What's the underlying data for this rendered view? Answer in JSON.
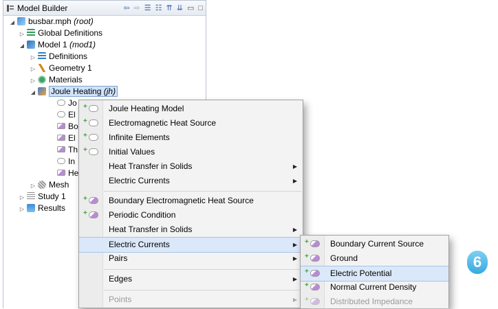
{
  "window": {
    "title": "Model Builder",
    "title_icon": "model-tree-icon"
  },
  "toolbar": {
    "icons": [
      "back-arrow-icon",
      "forward-arrow-icon",
      "expand-icon",
      "collapse-icon",
      "sort-up-icon",
      "sort-down-icon",
      "minimize-icon",
      "maximize-icon"
    ]
  },
  "tree": {
    "root": {
      "name": "busbar.mph",
      "suffix": "(root)"
    },
    "global": "Global Definitions",
    "model": {
      "name": "Model 1",
      "suffix": "(mod1)"
    },
    "definitions": "Definitions",
    "geometry": "Geometry 1",
    "materials": "Materials",
    "joule": {
      "name": "Joule Heating",
      "suffix": "(jh)"
    },
    "children": [
      "Jo",
      "El",
      "Bo",
      "El",
      "Th",
      "In",
      "He"
    ],
    "mesh": "Mesh",
    "study": "Study 1",
    "results": "Results"
  },
  "menu1": {
    "items": [
      {
        "label": "Joule Heating Model"
      },
      {
        "label": "Electromagnetic Heat Source"
      },
      {
        "label": "Infinite Elements"
      },
      {
        "label": "Initial Values"
      },
      {
        "label": "Heat Transfer in Solids"
      },
      {
        "label": "Electric Currents"
      },
      {
        "label": "Boundary Electromagnetic Heat Source"
      },
      {
        "label": "Periodic Condition"
      },
      {
        "label": "Heat Transfer in Solids"
      },
      {
        "label": "Electric Currents"
      },
      {
        "label": "Pairs"
      },
      {
        "label": "Edges"
      },
      {
        "label": "Points"
      }
    ]
  },
  "menu2": {
    "items": [
      {
        "label": "Boundary Current Source"
      },
      {
        "label": "Ground"
      },
      {
        "label": "Electric Potential"
      },
      {
        "label": "Normal Current Density"
      },
      {
        "label": "Distributed Impedance"
      }
    ]
  },
  "step_badge": "6",
  "colors": {
    "accent": "#3da33d",
    "highlight": "#dbe8f9",
    "badge": "#38a9e0"
  }
}
